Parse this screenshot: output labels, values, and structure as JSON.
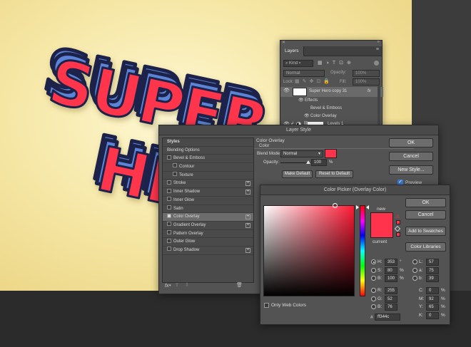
{
  "canvas": {
    "artwork_text_line1": "SUPER",
    "artwork_text_line2": "HERO",
    "colors": {
      "face": "#ff344c",
      "side": "#5b84d6",
      "outline": "#1b2148",
      "background": "#f6e8a8"
    }
  },
  "layers_panel": {
    "tab": "Layers",
    "kind_filter": "Kind",
    "blend_mode": "Normal",
    "opacity_label": "Opacity:",
    "opacity_value": "100%",
    "lock_label": "Lock:",
    "fill_label": "Fill:",
    "fill_value": "100%",
    "layers": [
      {
        "name": "Super Hero copy 31",
        "fx": "fx"
      },
      {
        "name": "Effects"
      },
      {
        "name": "Bevel & Emboss"
      },
      {
        "name": "Color Overlay"
      },
      {
        "name": "Levels 1"
      }
    ]
  },
  "layer_style": {
    "title": "Layer Style",
    "styles_header": "Styles",
    "items": [
      {
        "label": "Blending Options",
        "check": false,
        "plus": false,
        "indent": 0,
        "selected": false
      },
      {
        "label": "Bevel & Emboss",
        "check": true,
        "checked": false,
        "plus": false,
        "indent": 0,
        "selected": false
      },
      {
        "label": "Contour",
        "check": true,
        "checked": false,
        "plus": false,
        "indent": 1,
        "selected": false
      },
      {
        "label": "Texture",
        "check": true,
        "checked": false,
        "plus": false,
        "indent": 1,
        "selected": false
      },
      {
        "label": "Stroke",
        "check": true,
        "checked": false,
        "plus": true,
        "indent": 0,
        "selected": false
      },
      {
        "label": "Inner Shadow",
        "check": true,
        "checked": false,
        "plus": true,
        "indent": 0,
        "selected": false
      },
      {
        "label": "Inner Glow",
        "check": true,
        "checked": false,
        "plus": false,
        "indent": 0,
        "selected": false
      },
      {
        "label": "Satin",
        "check": true,
        "checked": false,
        "plus": false,
        "indent": 0,
        "selected": false
      },
      {
        "label": "Color Overlay",
        "check": true,
        "checked": true,
        "plus": true,
        "indent": 0,
        "selected": true
      },
      {
        "label": "Gradient Overlay",
        "check": true,
        "checked": false,
        "plus": true,
        "indent": 0,
        "selected": false
      },
      {
        "label": "Pattern Overlay",
        "check": true,
        "checked": false,
        "plus": false,
        "indent": 0,
        "selected": false
      },
      {
        "label": "Outer Glow",
        "check": true,
        "checked": false,
        "plus": false,
        "indent": 0,
        "selected": false
      },
      {
        "label": "Drop Shadow",
        "check": true,
        "checked": false,
        "plus": true,
        "indent": 0,
        "selected": false
      }
    ],
    "fx_label": "fx",
    "section_title": "Color Overlay",
    "section_subtitle": "Color",
    "blend_mode_label": "Blend Mode:",
    "blend_mode_value": "Normal",
    "overlay_color": "#ff344c",
    "opacity_label": "Opacity:",
    "opacity_value": "100",
    "opacity_unit": "%",
    "make_default": "Make Default",
    "reset_default": "Reset to Default",
    "ok": "OK",
    "cancel": "Cancel",
    "new_style": "New Style...",
    "preview": "Preview"
  },
  "color_picker": {
    "title": "Color Picker (Overlay Color)",
    "new_label": "new",
    "current_label": "current",
    "ok": "OK",
    "cancel": "Cancel",
    "add_swatches": "Add to Swatches",
    "color_libraries": "Color Libraries",
    "only_web": "Only Web Colors",
    "hsb": [
      {
        "label": "H:",
        "value": "353",
        "unit": "°",
        "selected": true
      },
      {
        "label": "S:",
        "value": "80",
        "unit": "%",
        "selected": false
      },
      {
        "label": "B:",
        "value": "100",
        "unit": "%",
        "selected": false
      }
    ],
    "rgb": [
      {
        "label": "R:",
        "value": "255"
      },
      {
        "label": "G:",
        "value": "52"
      },
      {
        "label": "B:",
        "value": "76"
      }
    ],
    "lab": [
      {
        "label": "L:",
        "value": "57"
      },
      {
        "label": "a:",
        "value": "75"
      },
      {
        "label": "b:",
        "value": "39"
      }
    ],
    "cmyk": [
      {
        "label": "C:",
        "value": "0",
        "unit": "%"
      },
      {
        "label": "M:",
        "value": "92",
        "unit": "%"
      },
      {
        "label": "Y:",
        "value": "65",
        "unit": "%"
      },
      {
        "label": "K:",
        "value": "0",
        "unit": "%"
      }
    ],
    "hex_label": "#",
    "hex_value": "ff344c",
    "new_color": "#ff344c",
    "current_color": "#ff344c"
  }
}
